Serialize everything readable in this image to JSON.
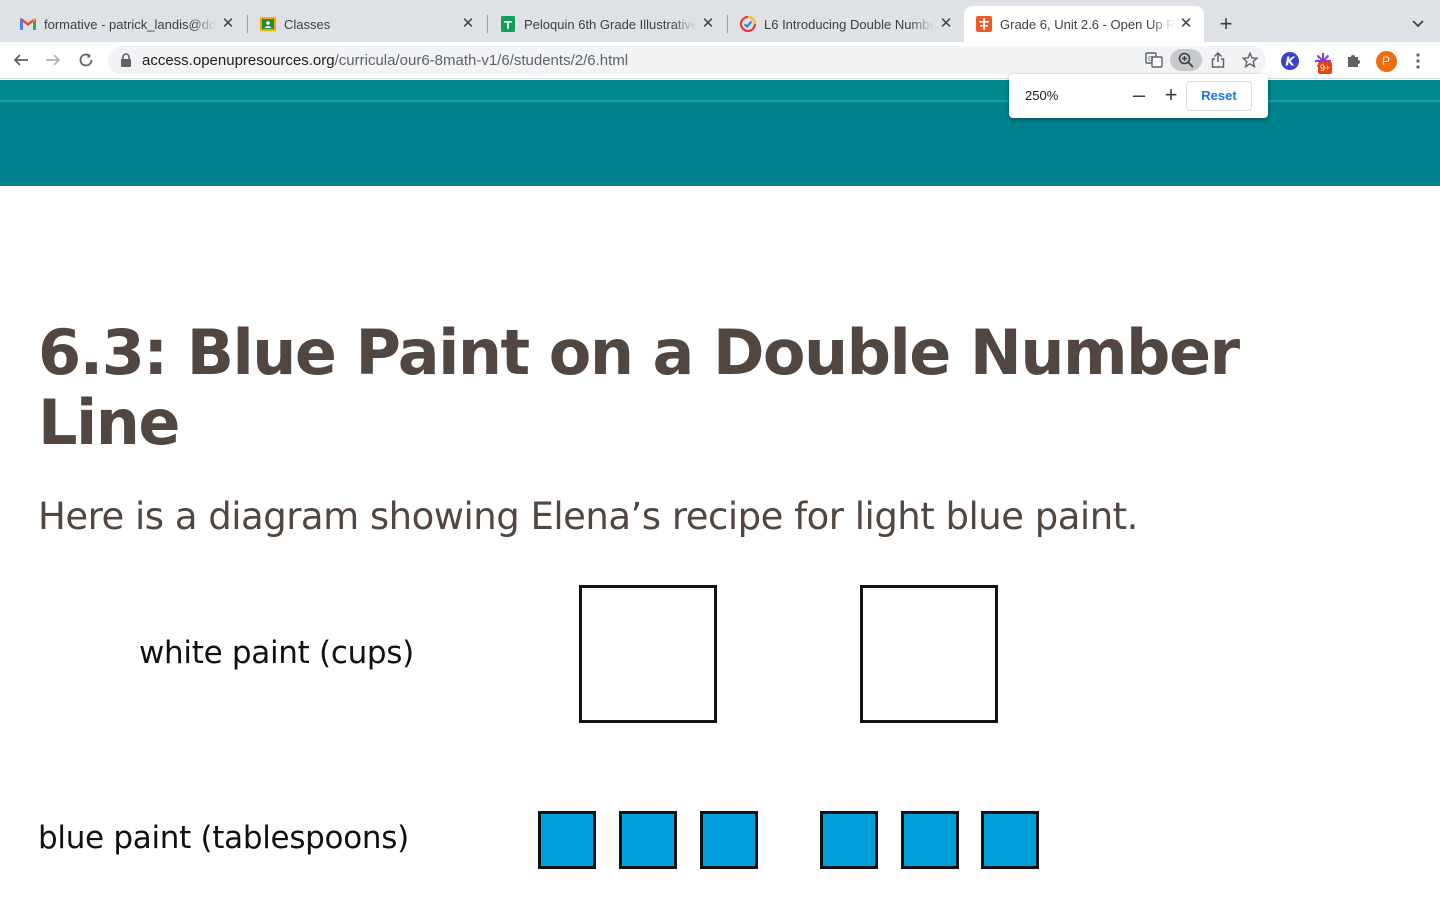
{
  "browser": {
    "tabs": [
      {
        "title": "formative - patrick_landis@dds",
        "icon": "gmail-icon"
      },
      {
        "title": "Classes",
        "icon": "google-classroom-icon"
      },
      {
        "title": "Peloquin 6th Grade Illustrative",
        "icon": "google-sheets-icon"
      },
      {
        "title": "L6 Introducing Double Number",
        "icon": "formative-icon"
      },
      {
        "title": "Grade 6, Unit 2.6 - Open Up Re",
        "icon": "open-up-resources-icon",
        "active": true
      }
    ],
    "address": {
      "domain": "access.openupresources.org",
      "path": "/curricula/our6-8math-v1/6/students/2/6.html"
    },
    "profile_initial": "P",
    "extension_badge": "9+",
    "zoom": {
      "level": "250%",
      "minus": "–",
      "plus": "+",
      "reset_label": "Reset"
    }
  },
  "page": {
    "heading": "6.3: Blue Paint on a Double Number Line",
    "intro": "Here is a diagram showing Elena’s recipe for light blue paint.",
    "diagram": {
      "white_label": "white paint (cups)",
      "blue_label": "blue paint (tablespoons)",
      "white_squares": 2,
      "blue_squares": 6,
      "blue_color": "#009fdb"
    }
  },
  "colors": {
    "banner": "#00838f",
    "heading_text": "#514640",
    "accent_link": "#1a73e8"
  }
}
